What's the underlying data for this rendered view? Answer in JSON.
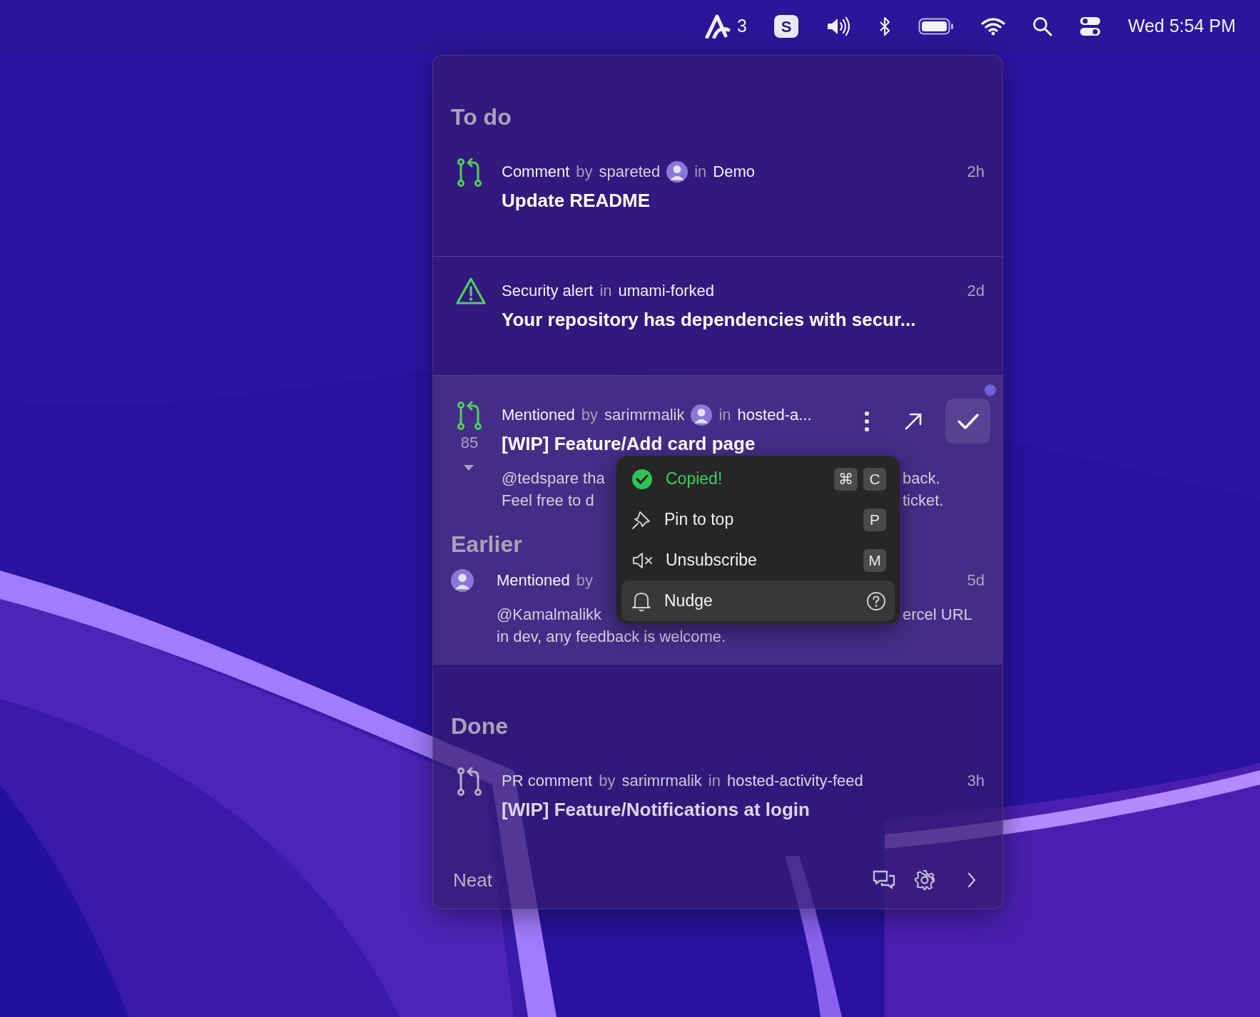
{
  "menu_bar": {
    "app_badge": {
      "count": "3"
    },
    "letter_app": "S",
    "clock": "Wed 5:54 PM"
  },
  "panel": {
    "sections": [
      {
        "title": "To do",
        "done": false,
        "highlighted": false,
        "items": [
          {
            "kind": "pull-request",
            "meta": [
              {
                "kind": "strong",
                "text": "Comment"
              },
              {
                "kind": "dim",
                "text": "by"
              },
              {
                "kind": "user",
                "text": "spareted"
              },
              {
                "kind": "avatar"
              },
              {
                "kind": "dim",
                "text": "in"
              },
              {
                "kind": "strong",
                "text": "Demo"
              }
            ],
            "time": "2h",
            "title": "Update README",
            "selected": false,
            "unread": false,
            "hovered": false
          },
          {
            "kind": "alert",
            "meta": [
              {
                "kind": "strong",
                "text": "Security alert"
              },
              {
                "kind": "dim",
                "text": "in"
              },
              {
                "kind": "strong",
                "text": "umami-forked"
              }
            ],
            "time": "2d",
            "title": "Your repository has dependencies with secur...",
            "selected": false,
            "unread": false,
            "hovered": false
          },
          {
            "kind": "pull-request",
            "count": "85",
            "meta": [
              {
                "kind": "strong",
                "text": "Mentioned"
              },
              {
                "kind": "dim",
                "text": "by"
              },
              {
                "kind": "user",
                "text": "sarimrmalik"
              },
              {
                "kind": "avatar"
              },
              {
                "kind": "dim",
                "text": "in"
              },
              {
                "kind": "strong",
                "text": "hosted-a..."
              }
            ],
            "title": "[WIP] Feature/Add card page",
            "body": [
              {
                "left": "@tedspare tha",
                "right": "back."
              },
              {
                "left": "Feel free to d",
                "right": "ticket."
              }
            ],
            "selected": true,
            "unread": true,
            "hovered": true
          }
        ]
      },
      {
        "title": "Earlier",
        "done": false,
        "highlighted": true,
        "items": [
          {
            "kind": "avatar",
            "meta": [
              {
                "kind": "strong",
                "text": "Mentioned"
              },
              {
                "kind": "dim",
                "text": "by"
              }
            ],
            "time": "5d",
            "body": [
              {
                "left": "@Kamalmalikk",
                "right": "ercel URL"
              },
              {
                "left": "in dev, any feedback is welcome."
              }
            ],
            "selected": false,
            "unread": false,
            "hovered": false
          }
        ]
      },
      {
        "title": "Done",
        "done": true,
        "highlighted": false,
        "items": [
          {
            "kind": "pull-request",
            "meta": [
              {
                "kind": "strong",
                "text": "PR comment"
              },
              {
                "kind": "dim",
                "text": "by"
              },
              {
                "kind": "user",
                "text": "sarimrmalik"
              },
              {
                "kind": "dim",
                "text": "in"
              },
              {
                "kind": "strong",
                "text": "hosted-activity-feed"
              }
            ],
            "time": "3h",
            "title": "[WIP] Feature/Notifications at login",
            "selected": false,
            "unread": false,
            "hovered": false
          }
        ]
      }
    ],
    "footer": {
      "app_name": "Neat"
    }
  },
  "context_menu": {
    "items": [
      {
        "kind": "copied",
        "label": "Copied!",
        "keys": [
          "⌘",
          "C"
        ],
        "selected": false
      },
      {
        "kind": "pin",
        "label": "Pin to top",
        "keys": [
          "P"
        ],
        "selected": false
      },
      {
        "kind": "unsubscribe",
        "label": "Unsubscribe",
        "keys": [
          "M"
        ],
        "selected": false
      },
      {
        "kind": "nudge",
        "label": "Nudge",
        "help": true,
        "selected": true
      }
    ]
  }
}
